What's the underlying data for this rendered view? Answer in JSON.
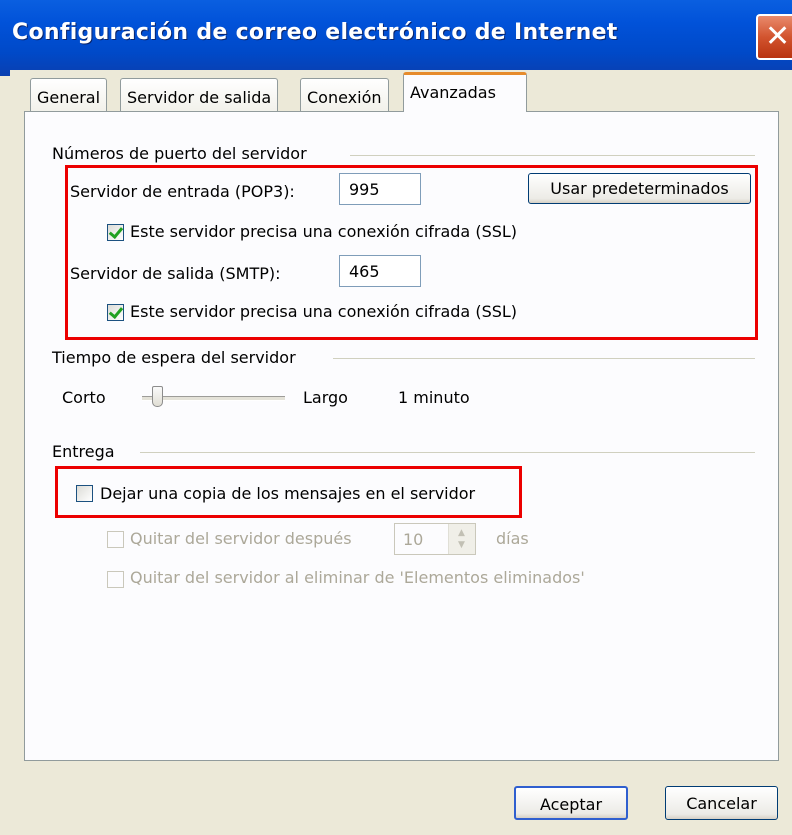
{
  "window": {
    "title": "Configuración de correo electrónico de Internet",
    "close_label": "✕"
  },
  "tabs": [
    {
      "label": "General"
    },
    {
      "label": "Servidor de salida"
    },
    {
      "label": "Conexión"
    },
    {
      "label": "Avanzadas"
    }
  ],
  "ports": {
    "section_label": "Números de puerto del servidor",
    "incoming_label": "Servidor de entrada (POP3):",
    "incoming_value": "995",
    "defaults_button": "Usar predeterminados",
    "incoming_ssl_label": "Este servidor precisa una conexión cifrada (SSL)",
    "incoming_ssl_checked": true,
    "outgoing_label": "Servidor de salida (SMTP):",
    "outgoing_value": "465",
    "outgoing_ssl_label": "Este servidor precisa una conexión cifrada (SSL)",
    "outgoing_ssl_checked": true
  },
  "timeout": {
    "section_label": "Tiempo de espera del servidor",
    "short_label": "Corto",
    "long_label": "Largo",
    "value_label": "1 minuto",
    "level": 0.1
  },
  "delivery": {
    "section_label": "Entrega",
    "leave_copy_label": "Dejar una copia de los mensajes en el servidor",
    "leave_copy_checked": false,
    "remove_after_label": "Quitar del servidor después",
    "remove_after_days": "10",
    "days_label": "días",
    "remove_on_delete_label": "Quitar del servidor al eliminar de 'Elementos eliminados'"
  },
  "buttons": {
    "ok": "Aceptar",
    "cancel": "Cancelar"
  },
  "colors": {
    "highlight": "#ec0000",
    "titlebar": "#0152d9",
    "active_tab_accent": "#e68b2c"
  }
}
